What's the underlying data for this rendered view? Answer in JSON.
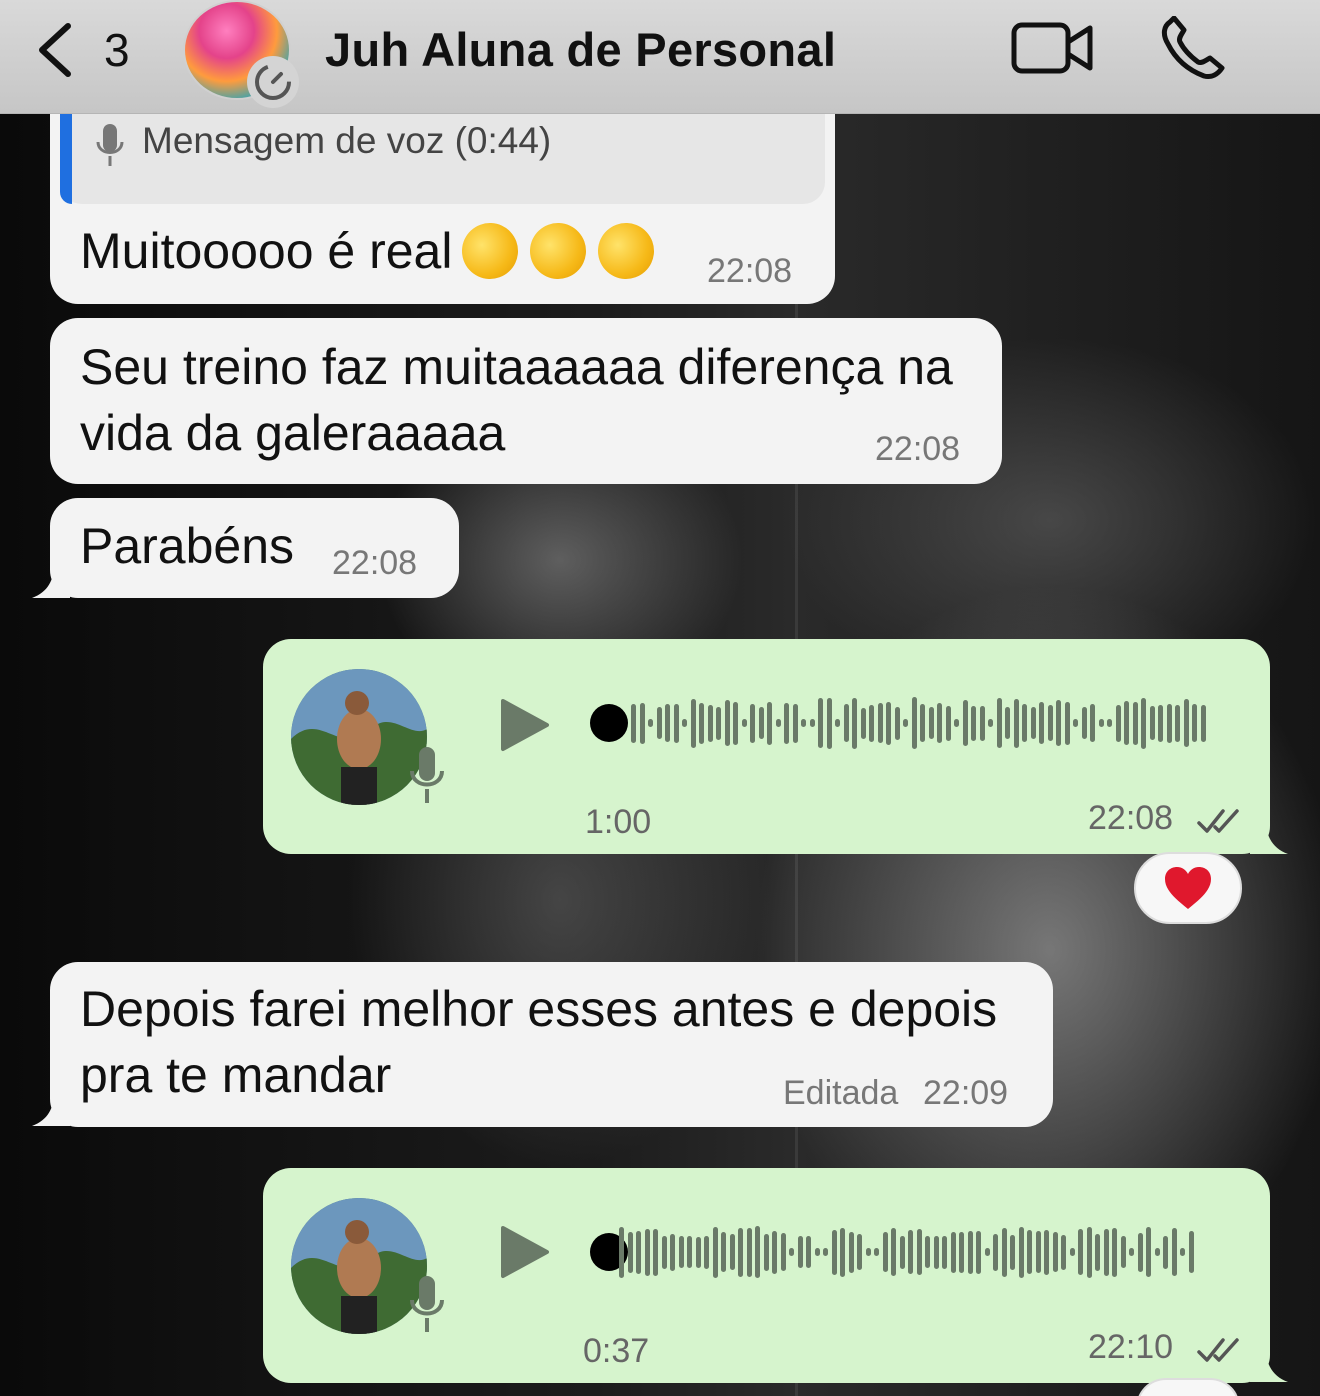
{
  "header": {
    "back_count": "3",
    "contact_name": "Juh Aluna de Personal"
  },
  "messages": [
    {
      "id": "m1",
      "direction": "incoming",
      "reply_preview": "Mensagem de voz (0:44)",
      "text": "Muitooooo é real",
      "emojis": [
        "rofl",
        "rofl",
        "rofl"
      ],
      "time": "22:08"
    },
    {
      "id": "m2",
      "direction": "incoming",
      "text_line1": "Seu treino faz muitaaaaaa diferença na",
      "text_line2": "vida da galeraaaaa",
      "time": "22:08"
    },
    {
      "id": "m3",
      "direction": "incoming",
      "text": "Parabéns",
      "time": "22:08"
    },
    {
      "id": "m4",
      "direction": "outgoing",
      "type": "voice",
      "duration": "1:00",
      "time": "22:08",
      "status": "read",
      "reaction": "heart"
    },
    {
      "id": "m5",
      "direction": "incoming",
      "text_line1": "Depois farei melhor esses antes e depois",
      "text_line2": "pra te mandar",
      "edited_label": "Editada",
      "time": "22:09"
    },
    {
      "id": "m6",
      "direction": "outgoing",
      "type": "voice",
      "duration": "0:37",
      "time": "22:10",
      "status": "read"
    }
  ],
  "icons": {
    "back": "chevron-left-icon",
    "video": "video-camera-icon",
    "call": "phone-icon",
    "mic": "microphone-icon",
    "play": "play-icon",
    "ticks": "double-check-icon",
    "reaction": "heart-icon"
  },
  "colors": {
    "header_bg": "#cfcfcf",
    "incoming_bubble": "#f3f3f3",
    "outgoing_bubble": "#d6f4cd",
    "reply_bar": "#1f6fe0",
    "heart": "#e0182d"
  }
}
